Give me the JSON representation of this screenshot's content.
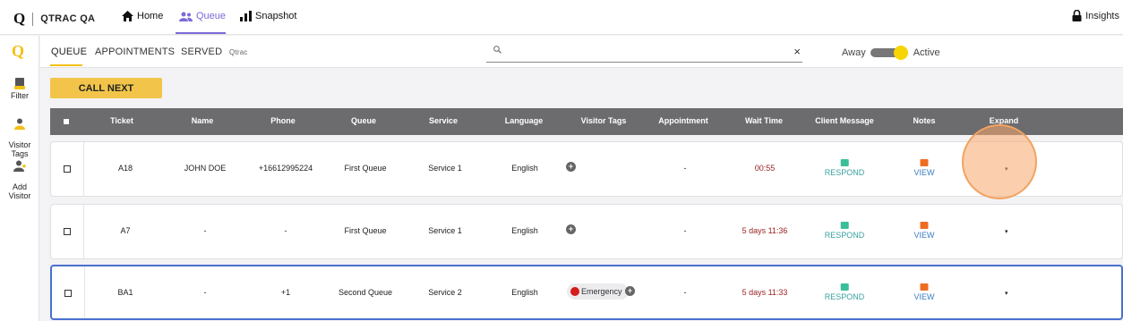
{
  "app": {
    "logo_char": "Q",
    "name": "QTRAC QA"
  },
  "nav": [
    {
      "label": "Home",
      "icon": "home-icon",
      "active": false
    },
    {
      "label": "Queue",
      "icon": "people-icon",
      "active": true
    },
    {
      "label": "Snapshot",
      "icon": "bar-chart-icon",
      "active": false
    }
  ],
  "insights": {
    "label": "Insights",
    "icon": "lock-icon"
  },
  "sidebar": {
    "logo_char": "Q",
    "items": [
      {
        "label": "Filter",
        "icon": "filter-icon"
      },
      {
        "label": "Visitor\nTags",
        "icon": "visitor-tags-icon"
      },
      {
        "label": "Add\nVisitor",
        "icon": "add-visitor-icon"
      }
    ]
  },
  "subtabs": {
    "queue": "QUEUE",
    "appointments": "APPOINTMENTS",
    "served": "SERVED",
    "site": "Qtrac"
  },
  "search": {
    "value": "",
    "placeholder": "",
    "clear": "×"
  },
  "status": {
    "away": "Away",
    "active": "Active",
    "is_active": true
  },
  "call_next": "CALL NEXT",
  "columns": [
    "Ticket",
    "Name",
    "Phone",
    "Queue",
    "Service",
    "Language",
    "Visitor Tags",
    "Appointment",
    "Wait Time",
    "Client Message",
    "Notes",
    "Expand"
  ],
  "rows": [
    {
      "ticket": "A18",
      "name": "JOHN DOE",
      "phone": "+16612995224",
      "queue": "First Queue",
      "service": "Service 1",
      "language": "English",
      "tag": "",
      "appointment": "-",
      "wait": "00:55",
      "message": "RESPOND",
      "notes": "VIEW",
      "expand": "▾"
    },
    {
      "ticket": "A7",
      "name": "-",
      "phone": "-",
      "queue": "First Queue",
      "service": "Service 1",
      "language": "English",
      "tag": "",
      "appointment": "-",
      "wait": "5 days 11:36",
      "message": "RESPOND",
      "notes": "VIEW",
      "expand": "▾"
    },
    {
      "ticket": "BA1",
      "name": "-",
      "phone": "+1",
      "queue": "Second Queue",
      "service": "Service 2",
      "language": "English",
      "tag": "Emergency",
      "appointment": "-",
      "wait": "5 days 11:33",
      "message": "RESPOND",
      "notes": "VIEW",
      "expand": "▾"
    }
  ],
  "colors": {
    "accent": "#f2c012",
    "nav_active": "#7a6ad8",
    "header_bg": "#6c6c6e",
    "wait_time": "#9b2222",
    "respond": "#3aa1a0",
    "view": "#3a7cc1",
    "emergency": "#d51b1b"
  }
}
